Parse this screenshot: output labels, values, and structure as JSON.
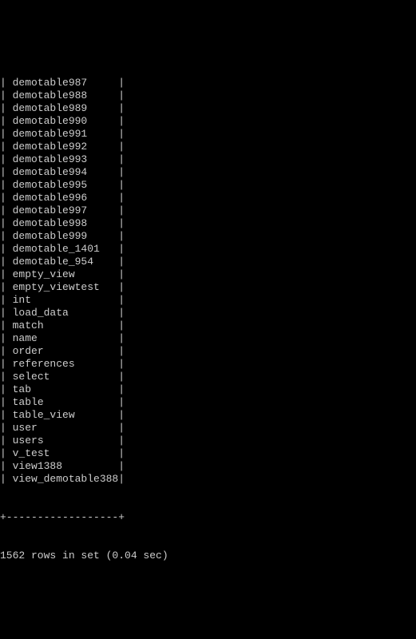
{
  "column_inner_width": 18,
  "rows": [
    "demotable987",
    "demotable988",
    "demotable989",
    "demotable990",
    "demotable991",
    "demotable992",
    "demotable993",
    "demotable994",
    "demotable995",
    "demotable996",
    "demotable997",
    "demotable998",
    "demotable999",
    "demotable_1401",
    "demotable_954",
    "empty_view",
    "empty_viewtest",
    "int",
    "load_data",
    "match",
    "name",
    "order",
    "references",
    "select",
    "tab",
    "table",
    "table_view",
    "user",
    "users",
    "v_test",
    "view1388",
    "view_demotable388"
  ],
  "border": "+------------------+",
  "footer": "1562 rows in set (0.04 sec)"
}
